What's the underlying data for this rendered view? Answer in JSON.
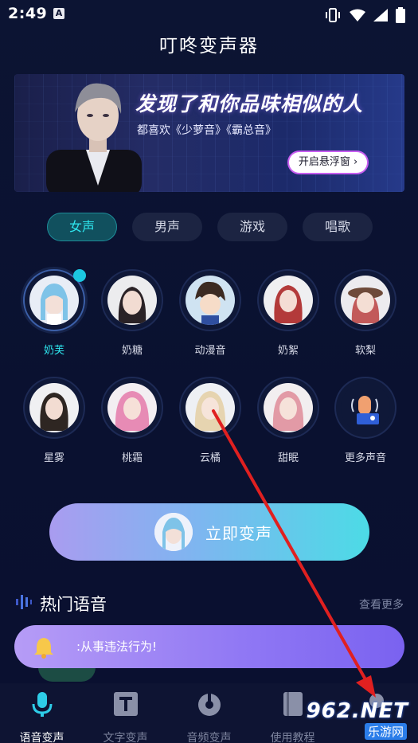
{
  "status": {
    "time": "2:49",
    "notif_letter": "A"
  },
  "app": {
    "title": "叮咚变声器"
  },
  "banner": {
    "headline": "发现了和你品味相似的人",
    "subtitle": "都喜欢《少萝音》《霸总音》",
    "button_label": "开启悬浮窗 ›"
  },
  "tabs": [
    {
      "label": "女声",
      "active": true
    },
    {
      "label": "男声",
      "active": false
    },
    {
      "label": "游戏",
      "active": false
    },
    {
      "label": "唱歌",
      "active": false
    }
  ],
  "voices": [
    {
      "label": "奶芙",
      "selected": true
    },
    {
      "label": "奶糖",
      "selected": false
    },
    {
      "label": "动漫音",
      "selected": false
    },
    {
      "label": "奶絮",
      "selected": false
    },
    {
      "label": "软梨",
      "selected": false
    },
    {
      "label": "星雾",
      "selected": false
    },
    {
      "label": "桃霜",
      "selected": false
    },
    {
      "label": "云橘",
      "selected": false
    },
    {
      "label": "甜眠",
      "selected": false
    },
    {
      "label": "更多声音",
      "selected": false
    }
  ],
  "convert": {
    "label": "立即变声"
  },
  "hot": {
    "title": "热门语音",
    "more": "查看更多"
  },
  "toast": {
    "text": ":从事违法行为!"
  },
  "nav": [
    {
      "label": "语音变声",
      "icon": "mic-icon",
      "active": true
    },
    {
      "label": "文字变声",
      "icon": "text-t-icon",
      "active": false
    },
    {
      "label": "音频变声",
      "icon": "audio-disc-icon",
      "active": false
    },
    {
      "label": "使用教程",
      "icon": "book-icon",
      "active": false
    },
    {
      "label": "",
      "icon": "profile-icon",
      "active": false
    }
  ],
  "watermark": {
    "top": "962.NET",
    "bottom": "乐游网"
  },
  "colors": {
    "accent": "#2ee6ee",
    "background": "#0b1230",
    "arrow": "#e02020"
  }
}
